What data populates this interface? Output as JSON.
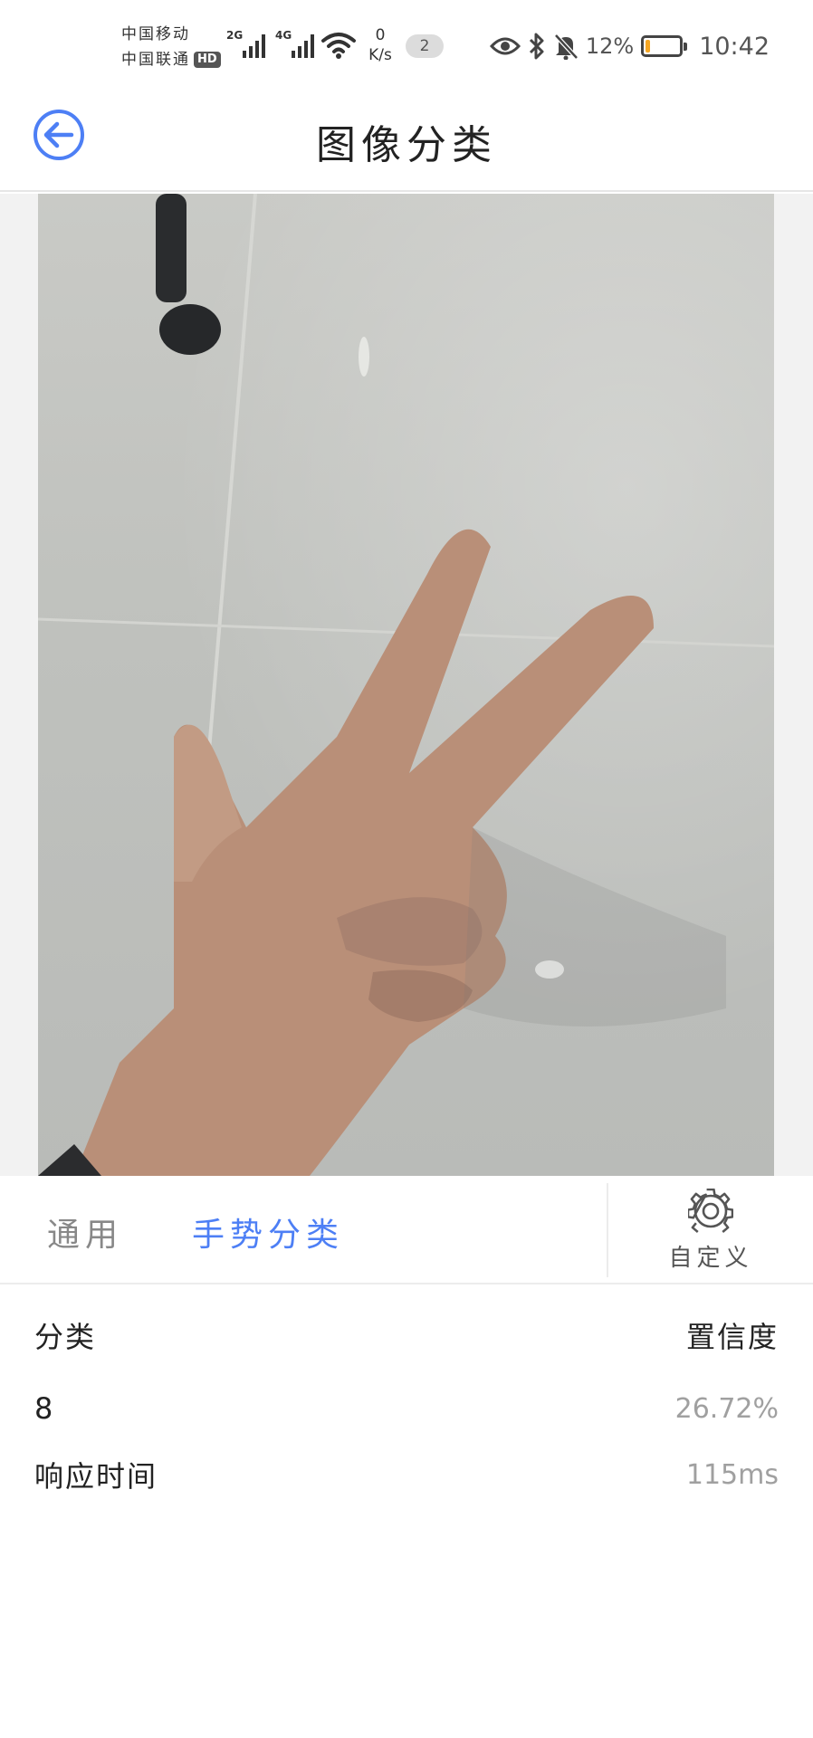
{
  "status_bar": {
    "carrier_1": "中国移动",
    "carrier_2": "中国联通",
    "hd_badge": "HD",
    "network_1": "2G",
    "network_2": "4G",
    "net_speed_value": "0",
    "net_speed_unit": "K/s",
    "notification_count": "2",
    "battery_percent": "12%",
    "battery_level": 0.12,
    "time": "10:42",
    "icons": [
      "eye-icon",
      "bluetooth-icon",
      "mute-bell-icon",
      "wifi-icon",
      "signal-icon"
    ]
  },
  "header": {
    "title": "图像分类",
    "back_icon": "arrow-left-circle-icon",
    "accent_color": "#4d7ff5"
  },
  "tabs": {
    "items": [
      {
        "label": "通用",
        "active": false
      },
      {
        "label": "手势分类",
        "active": true
      }
    ],
    "custom_label": "自定义",
    "custom_icon": "gear-icon"
  },
  "results": {
    "header_left": "分类",
    "header_right": "置信度",
    "class_value": "8",
    "confidence_value": "26.72%",
    "response_label": "响应时间",
    "response_value": "115ms"
  }
}
